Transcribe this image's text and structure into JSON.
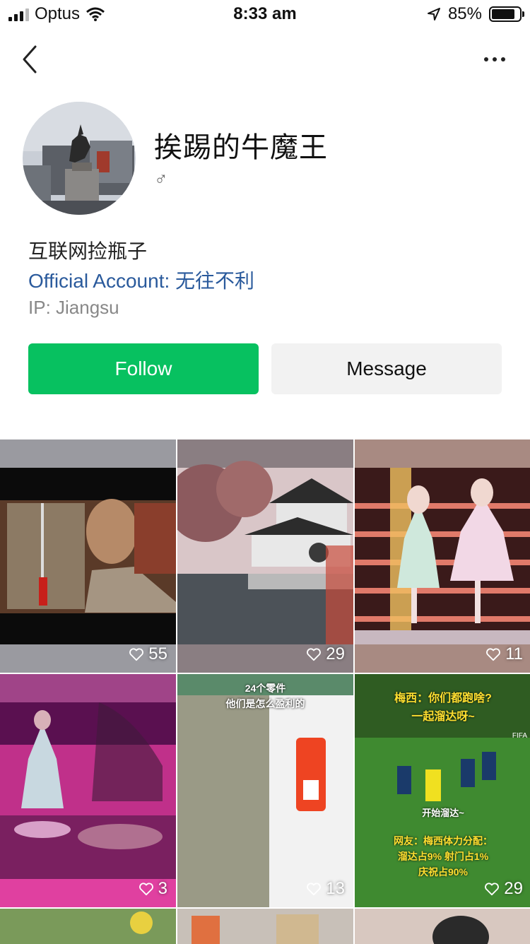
{
  "status": {
    "carrier": "Optus",
    "time": "8:33 am",
    "battery": "85%"
  },
  "profile": {
    "name": "挨踢的牛魔王",
    "gender_symbol": "♂",
    "bio": "互联网捡瓶子",
    "official_account": "Official Account: 无往不利",
    "ip": "IP: Jiangsu"
  },
  "actions": {
    "follow_label": "Follow",
    "message_label": "Message"
  },
  "videos": [
    {
      "likes": "55"
    },
    {
      "likes": "29"
    },
    {
      "likes": "11"
    },
    {
      "likes": "3"
    },
    {
      "likes": "13",
      "caption_1": "24个零件",
      "caption_2": "他们是怎么盈利的"
    },
    {
      "likes": "29",
      "caption_1": "梅西：你们都跑啥?",
      "caption_2": "一起溜达呀~",
      "caption_3": "开始溜达~",
      "caption_4": "网友：梅西体力分配：",
      "caption_5": "溜达占9%  射门占1%",
      "caption_6": "庆祝占90%",
      "badge": "FIFA"
    }
  ],
  "colors": {
    "follow_bg": "#07c160",
    "official_link": "#2a5a9c"
  },
  "icons": [
    "back-icon",
    "more-icon",
    "heart-icon",
    "location-arrow-icon",
    "wifi-icon",
    "battery-icon"
  ]
}
